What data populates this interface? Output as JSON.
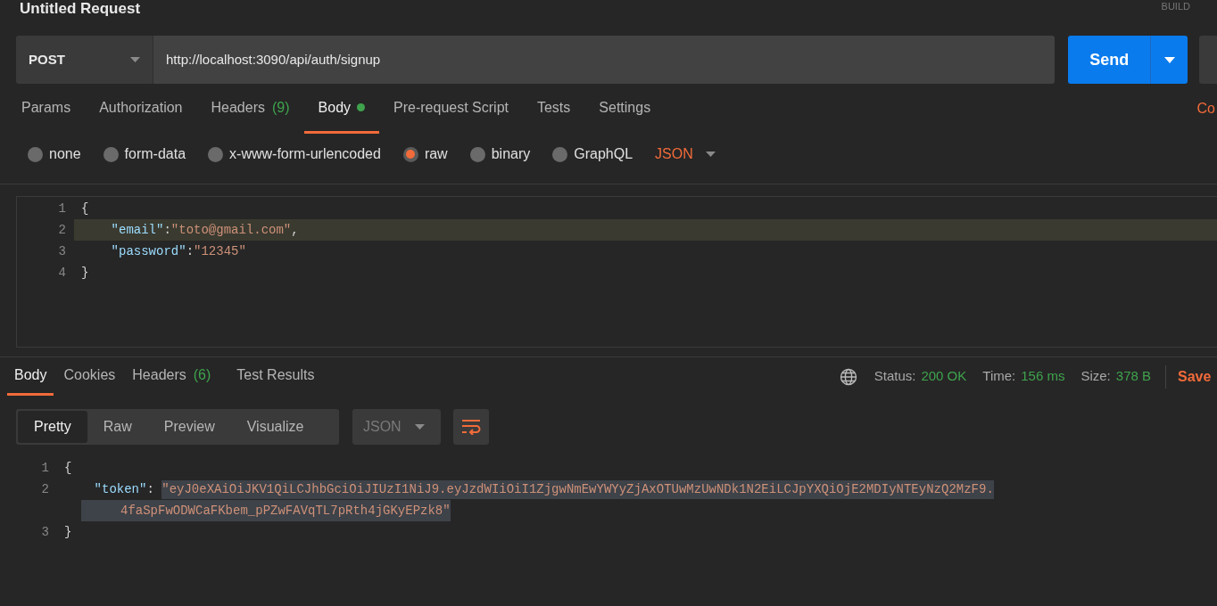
{
  "title": "Untitled Request",
  "build_label": "BUILD",
  "request": {
    "method": "POST",
    "url": "http://localhost:3090/api/auth/signup",
    "send": "Send"
  },
  "request_tabs": [
    {
      "label": "Params",
      "selected": false
    },
    {
      "label": "Authorization",
      "selected": false
    },
    {
      "label": "Headers",
      "count": "(9)",
      "selected": false
    },
    {
      "label": "Body",
      "dot": true,
      "selected": true
    },
    {
      "label": "Pre-request Script",
      "selected": false
    },
    {
      "label": "Tests",
      "selected": false
    },
    {
      "label": "Settings",
      "selected": false
    }
  ],
  "cookies_link": "Co",
  "body_types": [
    {
      "label": "none",
      "selected": false
    },
    {
      "label": "form-data",
      "selected": false
    },
    {
      "label": "x-www-form-urlencoded",
      "selected": false
    },
    {
      "label": "raw",
      "selected": true
    },
    {
      "label": "binary",
      "selected": false
    },
    {
      "label": "GraphQL",
      "selected": false
    }
  ],
  "body_format": "JSON",
  "request_body": [
    {
      "number": "1",
      "highlighted": false,
      "tokens": [
        {
          "kind": "bracket",
          "text": "{"
        }
      ]
    },
    {
      "number": "2",
      "highlighted": true,
      "tokens": [
        {
          "kind": "key",
          "text": "\"email\""
        },
        {
          "kind": "punct",
          "text": ":"
        },
        {
          "kind": "string",
          "text": "\"toto@gmail.com\""
        },
        {
          "kind": "punct",
          "text": ","
        }
      ]
    },
    {
      "number": "3",
      "highlighted": false,
      "tokens": [
        {
          "kind": "key",
          "text": "\"password\""
        },
        {
          "kind": "punct",
          "text": ":"
        },
        {
          "kind": "string",
          "text": "\"12345\""
        }
      ]
    },
    {
      "number": "4",
      "highlighted": false,
      "tokens": [
        {
          "kind": "bracket",
          "text": "}"
        }
      ]
    }
  ],
  "response_tabs": [
    {
      "label": "Body",
      "selected": true
    },
    {
      "label": "Cookies",
      "selected": false
    },
    {
      "label": "Headers",
      "count": "(6)",
      "selected": false
    },
    {
      "label": "Test Results",
      "selected": false
    }
  ],
  "status": [
    {
      "label": "Status:",
      "value": "200 OK"
    },
    {
      "label": "Time:",
      "value": "156 ms"
    },
    {
      "label": "Size:",
      "value": "378 B"
    }
  ],
  "save_link": "Save",
  "view_modes": [
    {
      "label": "Pretty",
      "selected": true
    },
    {
      "label": "Raw",
      "selected": false
    },
    {
      "label": "Preview",
      "selected": false
    },
    {
      "label": "Visualize",
      "selected": false
    }
  ],
  "response_format": "JSON",
  "response_body": [
    {
      "number": "1",
      "tokens": [
        {
          "kind": "bracket",
          "text": "{"
        }
      ]
    },
    {
      "number": "2",
      "tokens": [
        {
          "kind": "key",
          "text": "\"token\""
        },
        {
          "kind": "punct",
          "text": ": "
        },
        {
          "kind": "selected_string",
          "text": "\"eyJ0eXAiOiJKV1QiLCJhbGciOiJIUzI1NiJ9.eyJzdWIiOiI1ZjgwNmEwYWYyZjAxOTUwMzUwNDk1N2EiLCJpYXQiOjE2MDIyNTEyNzQ2MzF9."
        }
      ],
      "continuation": "4faSpFwODWCaFKbem_pPZwFAVqTL7pRth4jGKyEPzk8\""
    },
    {
      "number": "3",
      "tokens": [
        {
          "kind": "bracket",
          "text": "}"
        }
      ]
    }
  ]
}
